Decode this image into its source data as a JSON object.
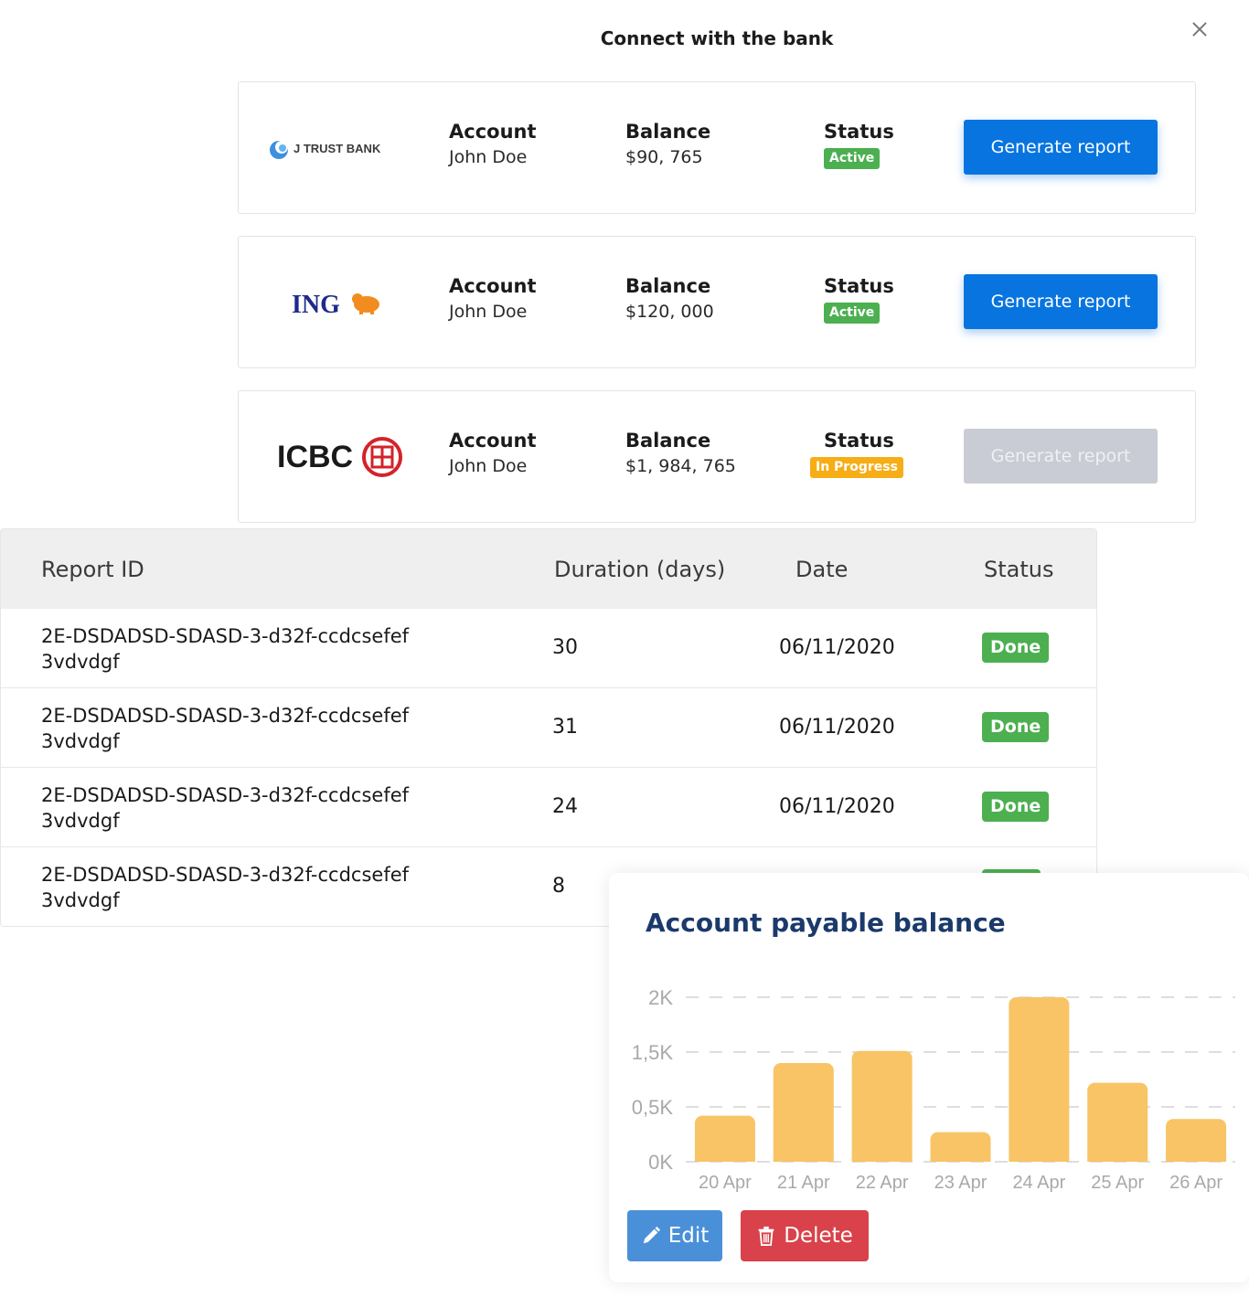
{
  "modal": {
    "title": "Connect with the bank"
  },
  "banks": [
    {
      "logo_text": "J TRUST BANK",
      "account_label": "Account",
      "account_value": "John Doe",
      "balance_label": "Balance",
      "balance_value": "$90, 765",
      "status_label": "Status",
      "status_value": "Active",
      "button_label": "Generate report",
      "button_enabled": true
    },
    {
      "logo_text": "ING",
      "account_label": "Account",
      "account_value": "John Doe",
      "balance_label": "Balance",
      "balance_value": "$120, 000",
      "status_label": "Status",
      "status_value": "Active",
      "button_label": "Generate report",
      "button_enabled": true
    },
    {
      "logo_text": "ICBC",
      "account_label": "Account",
      "account_value": "John Doe",
      "balance_label": "Balance",
      "balance_value": "$1, 984, 765",
      "status_label": "Status",
      "status_value": "In Progress",
      "button_label": "Generate report",
      "button_enabled": false
    }
  ],
  "reports": {
    "headers": [
      "Report ID",
      "Duration (days)",
      "Date",
      "Status"
    ],
    "rows": [
      {
        "id_line1": "2E-DSDADSD-SDASD-3-d32f-ccdcsefef",
        "id_line2": "3vdvdgf",
        "duration": "30",
        "date": "06/11/2020",
        "status": "Done"
      },
      {
        "id_line1": "2E-DSDADSD-SDASD-3-d32f-ccdcsefef",
        "id_line2": "3vdvdgf",
        "duration": "31",
        "date": "06/11/2020",
        "status": "Done"
      },
      {
        "id_line1": "2E-DSDADSD-SDASD-3-d32f-ccdcsefef",
        "id_line2": "3vdvdgf",
        "duration": "24",
        "date": "06/11/2020",
        "status": "Done"
      },
      {
        "id_line1": "2E-DSDADSD-SDASD-3-d32f-ccdcsefef",
        "id_line2": "3vdvdgf",
        "duration": "8",
        "date": "",
        "status": ""
      }
    ]
  },
  "chart_card": {
    "edit_label": "Edit",
    "delete_label": "Delete"
  },
  "chart_data": {
    "type": "bar",
    "title": "Account payable balance",
    "categories": [
      "20 Apr",
      "21 Apr",
      "22 Apr",
      "23 Apr",
      "24 Apr",
      "25 Apr",
      "26 Apr"
    ],
    "values": [
      420,
      900,
      1010,
      270,
      1500,
      720,
      390
    ],
    "ytick_values": [
      0,
      500,
      1000,
      1500
    ],
    "ytick_labels": [
      "0K",
      "0,5K",
      "1,5K",
      "2K"
    ],
    "ylim": [
      0,
      1500
    ],
    "grid": true,
    "bar_color": "#f8c466"
  },
  "colors": {
    "primary_button": "#0874e0",
    "active": "#4caf50",
    "in_progress": "#f6ad16",
    "edit": "#4a90d9",
    "delete": "#d9424a"
  }
}
